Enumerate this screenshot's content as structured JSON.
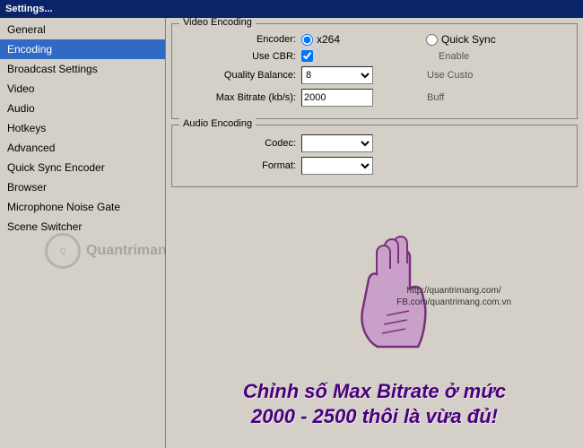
{
  "titleBar": {
    "label": "Settings..."
  },
  "sidebar": {
    "items": [
      {
        "id": "general",
        "label": "General",
        "active": false
      },
      {
        "id": "encoding",
        "label": "Encoding",
        "active": true
      },
      {
        "id": "broadcast-settings",
        "label": "Broadcast Settings",
        "active": false
      },
      {
        "id": "video",
        "label": "Video",
        "active": false
      },
      {
        "id": "audio",
        "label": "Audio",
        "active": false
      },
      {
        "id": "hotkeys",
        "label": "Hotkeys",
        "active": false
      },
      {
        "id": "advanced",
        "label": "Advanced",
        "active": false
      },
      {
        "id": "quick-sync-encoder",
        "label": "Quick Sync Encoder",
        "active": false
      },
      {
        "id": "browser",
        "label": "Browser",
        "active": false
      },
      {
        "id": "microphone-noise-gate",
        "label": "Microphone Noise Gate",
        "active": false
      },
      {
        "id": "scene-switcher",
        "label": "Scene Switcher",
        "active": false
      }
    ]
  },
  "content": {
    "videoEncoding": {
      "groupTitle": "Video Encoding",
      "encoderLabel": "Encoder:",
      "encoderOptions": [
        {
          "value": "x264",
          "label": "x264",
          "selected": true
        },
        {
          "value": "quicksync",
          "label": "Quick Sync",
          "selected": false
        }
      ],
      "useCBRLabel": "Use CBR:",
      "useCBRChecked": true,
      "qualityBalanceLabel": "Quality Balance:",
      "qualityBalanceValue": "8",
      "maxBitrateLabel": "Max Bitrate (kb/s):",
      "maxBitrateValue": "2000",
      "rightLabels": {
        "enable": "Enable",
        "useCustom": "Use Custo",
        "buff": "Buff"
      }
    },
    "audioEncoding": {
      "groupTitle": "Audio Encoding",
      "codecLabel": "Codec:",
      "formatLabel": "Format:"
    }
  },
  "overlay": {
    "urlText": "http://quantrimang.com/",
    "fbText": "FB.com/quantrimang.com.vn",
    "vietnameseText": "Chỉnh số Max Bitrate ở mức 2000 - 2500 thôi là vừa đủ!",
    "watermarkText": "Quantrimang"
  }
}
